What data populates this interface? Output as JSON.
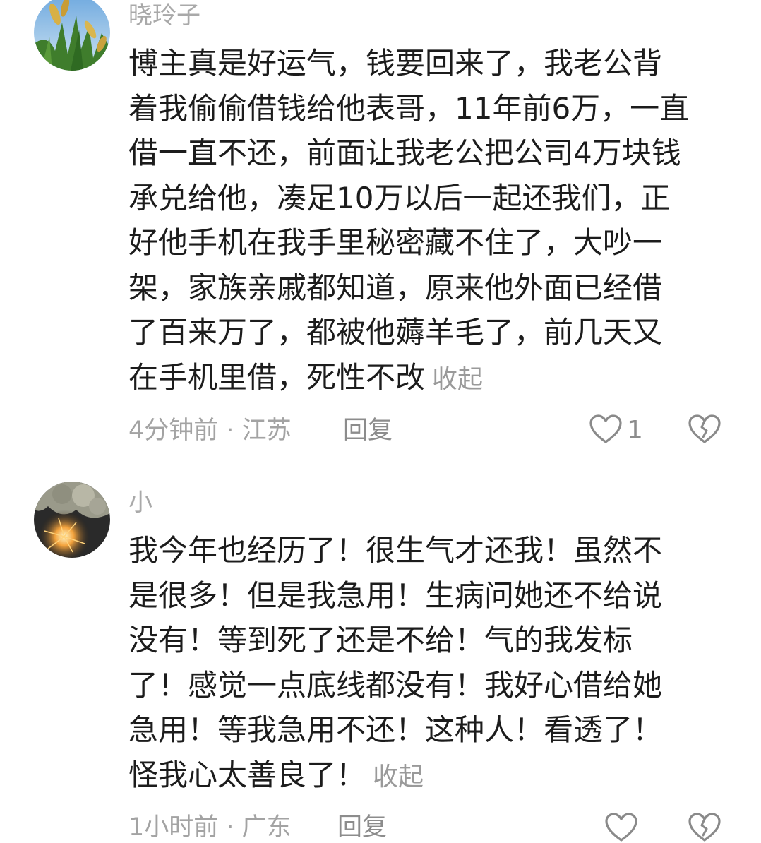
{
  "comments": [
    {
      "username": "晓玲子",
      "avatar": "rice-field-avatar",
      "lines": [
        "博主真是好运气，钱要回来了，我老公背",
        "着我偷偷借钱给他表哥，11年前6万，一直",
        "借一直不还，前面让我老公把公司4万块钱",
        "承兑给他，凑足10万以后一起还我们，正",
        "好他手机在我手里秘密藏不住了，大吵一",
        "架，家族亲戚都知道，原来他外面已经借",
        "了百来万了，都被他薅羊毛了，前几天又",
        "在手机里借，死性不改"
      ],
      "collapse_label": "收起",
      "meta": "4分钟前 · 江苏",
      "reply_label": "回复",
      "like_count": "1",
      "like_icon": "heart-outline-icon",
      "dislike_icon": "broken-heart-icon"
    },
    {
      "username": "小",
      "avatar": "sparkler-tree-avatar",
      "lines": [
        "我今年也经历了！很生气才还我！虽然不",
        "是很多！但是我急用！生病问她还不给说",
        "没有！等到死了还是不给！气的我发标",
        "了！感觉一点底线都没有！我好心借给她",
        "急用！等我急用不还！这种人！看透了！",
        "怪我心太善良了！"
      ],
      "collapse_label": "收起",
      "meta": "1小时前 · 广东",
      "reply_label": "回复",
      "like_icon": "heart-outline-icon",
      "dislike_icon": "broken-heart-icon"
    }
  ]
}
